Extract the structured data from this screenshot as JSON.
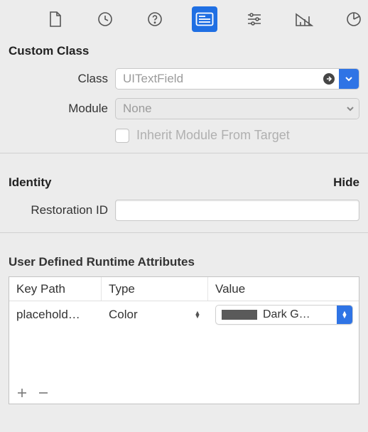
{
  "iconbar": {
    "tabs": [
      "file-icon",
      "history-icon",
      "help-icon",
      "identity-icon",
      "attributes-icon",
      "size-icon",
      "connections-icon"
    ],
    "active_index": 3
  },
  "custom_class": {
    "title": "Custom Class",
    "class_label": "Class",
    "class_placeholder": "UITextField",
    "module_label": "Module",
    "module_placeholder": "None",
    "inherit_label": "Inherit Module From Target"
  },
  "identity": {
    "title": "Identity",
    "hide_label": "Hide",
    "restoration_label": "Restoration ID"
  },
  "udra": {
    "title": "User Defined Runtime Attributes",
    "columns": {
      "key_path": "Key Path",
      "type": "Type",
      "value": "Value"
    },
    "row": {
      "key_path": "placehold…",
      "type": "Color",
      "value_text": "Dark G…",
      "swatch_color": "#5a5a5a"
    }
  }
}
